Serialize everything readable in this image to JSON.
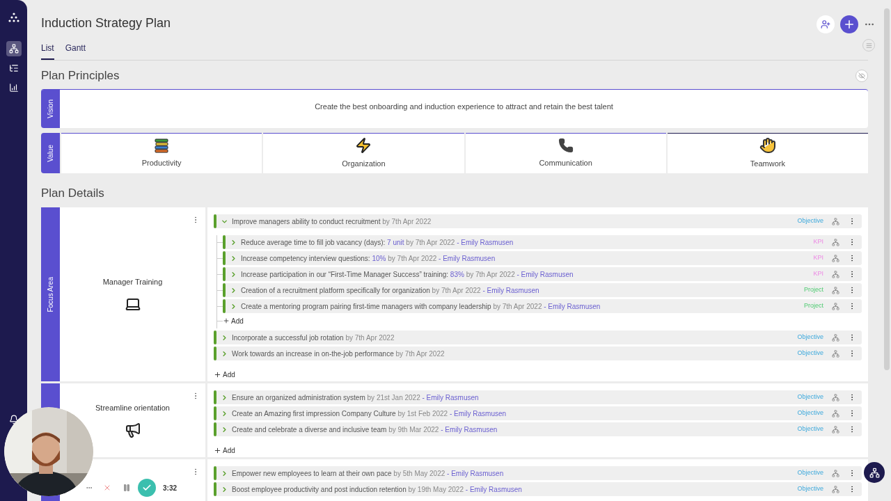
{
  "sidebar": {
    "nav": [
      {
        "selected": false
      },
      {
        "selected": true
      },
      {
        "selected": false
      },
      {
        "selected": false
      }
    ]
  },
  "title": "Induction Strategy Plan",
  "tabs": [
    {
      "label": "List",
      "selected": true
    },
    {
      "label": "Gantt",
      "selected": false
    }
  ],
  "principles": {
    "heading": "Plan Principles",
    "vision": {
      "label": "Vision",
      "text": "Create the best onboarding and induction experience to attract and retain the best talent"
    },
    "value": {
      "label": "Value",
      "items": [
        {
          "label": "Productivity"
        },
        {
          "label": "Organization"
        },
        {
          "label": "Communication"
        },
        {
          "label": "Teamwork"
        }
      ]
    }
  },
  "details": {
    "heading": "Plan Details",
    "areas": [
      {
        "label": "Focus Area",
        "name": "Manager Training",
        "add_label": "Add",
        "items": [
          {
            "title": "Improve managers ability to conduct recruitment",
            "date": "by 7th Apr 2022",
            "kind": "objective",
            "type": "Objective",
            "expanded": true,
            "add_label": "Add",
            "children": [
              {
                "title": "Reduce average time to fill job vacancy (days):",
                "value": "7 unit",
                "date": "by 7th Apr 2022",
                "owner": "- Emily Rasmusen",
                "kind": "kpi",
                "type": "KPI",
                "expanded": false
              },
              {
                "title": "Increase competency interview questions:",
                "value": "10%",
                "date": "by 7th Apr 2022",
                "owner": "- Emily Rasmusen",
                "kind": "kpi",
                "type": "KPI",
                "expanded": false
              },
              {
                "title": "Increase participation in our “First-Time Manager Success” training:",
                "value": "83%",
                "date": "by 7th Apr 2022",
                "owner": "- Emily Rasmusen",
                "kind": "kpi",
                "type": "KPI",
                "expanded": false
              },
              {
                "title": "Creation of a recruitment platform specifically for organization",
                "date": "by 7th Apr 2022",
                "owner": "- Emily Rasmusen",
                "kind": "project",
                "type": "Project",
                "expanded": false
              },
              {
                "title": "Create a mentoring program pairing first-time managers with company leadership",
                "date": "by 7th Apr 2022",
                "owner": "- Emily Rasmusen",
                "kind": "project",
                "type": "Project",
                "expanded": false
              }
            ]
          },
          {
            "title": "Incorporate a successful job rotation",
            "date": "by 7th Apr 2022",
            "kind": "objective",
            "type": "Objective",
            "expanded": false
          },
          {
            "title": "Work towards an increase in on-the-job performance",
            "date": "by 7th Apr 2022",
            "kind": "objective",
            "type": "Objective",
            "expanded": false
          }
        ]
      },
      {
        "name": "Streamline orientation",
        "add_label": "Add",
        "items": [
          {
            "title": "Ensure an organized administration system",
            "date": "by 21st Jan 2022",
            "owner": "- Emily Rasmusen",
            "kind": "objective",
            "type": "Objective",
            "expanded": false
          },
          {
            "title": "Create an Amazing first impression Company Culture",
            "date": "by 1st Feb 2022",
            "owner": "- Emily Rasmusen",
            "kind": "objective",
            "type": "Objective",
            "expanded": false
          },
          {
            "title": "Create and celebrate a diverse and inclusive team",
            "date": "by 9th Mar 2022",
            "owner": "- Emily Rasmusen",
            "kind": "objective",
            "type": "Objective",
            "expanded": false
          }
        ]
      },
      {
        "items": [
          {
            "title": "Empower new employees to learn at their own pace",
            "date": "by 5th May 2022",
            "owner": "- Emily Rasmusen",
            "kind": "objective",
            "type": "Objective",
            "expanded": false
          },
          {
            "title": "Boost employee productivity and post induction retention",
            "date": "by 19th May 2022",
            "owner": "- Emily Rasmusen",
            "kind": "objective",
            "type": "Objective",
            "expanded": false
          }
        ]
      }
    ]
  },
  "recorder": {
    "time": "3:32"
  }
}
